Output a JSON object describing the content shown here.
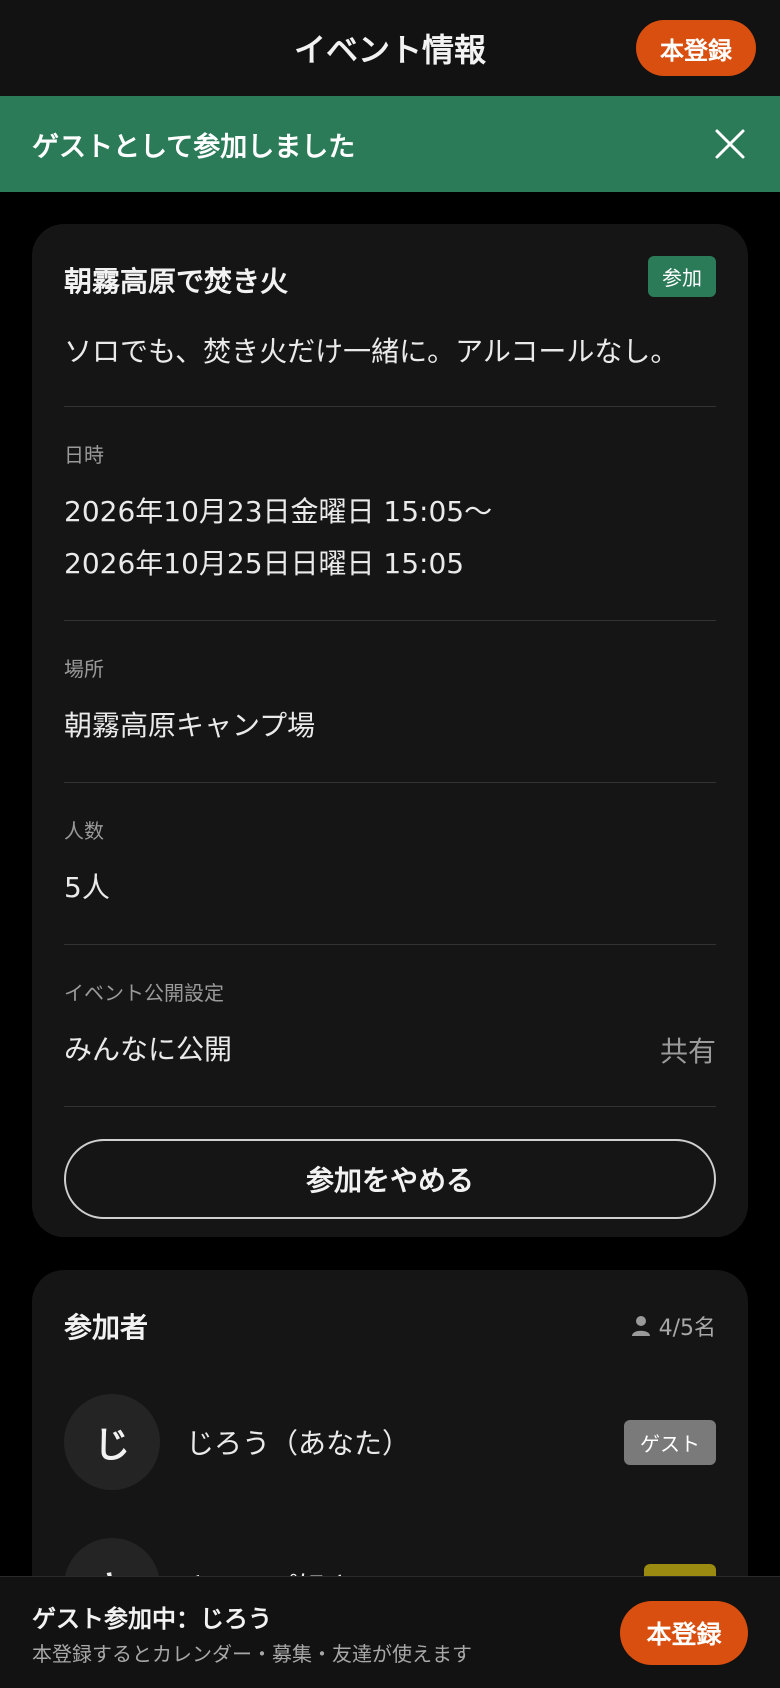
{
  "header": {
    "title": "イベント情報",
    "register_label": "本登録"
  },
  "toast": {
    "message": "ゲストとして参加しました",
    "close_icon": "close-icon"
  },
  "event": {
    "title": "朝霧高原で焚き火",
    "status_badge": "参加",
    "description": "ソロでも、焚き火だけ一緒に。アルコールなし。",
    "datetime_label": "日時",
    "datetime_start": "2026年10月23日金曜日 15:05〜",
    "datetime_end": "2026年10月25日日曜日 15:05",
    "place_label": "場所",
    "place_value": "朝霧高原キャンプ場",
    "capacity_label": "人数",
    "capacity_value": "5人",
    "visibility_label": "イベント公開設定",
    "visibility_value": "みんなに公開",
    "share_label": "共有",
    "cancel_label": "参加をやめる"
  },
  "participants": {
    "title": "参加者",
    "count": "4/5名",
    "members": [
      {
        "initial": "じ",
        "name": "じろう（あなた）",
        "badge": "ゲスト"
      },
      {
        "initial": "キ",
        "name": "キャンプ好き",
        "badge": "主催"
      }
    ]
  },
  "bottom_bar": {
    "title": "ゲスト参加中：じろう",
    "subtitle": "本登録するとカレンダー・募集・友達が使えます",
    "register_label": "本登録"
  },
  "colors": {
    "accent_orange": "#d94f0f",
    "toast_green": "#2b7a58",
    "guest_badge": "#7a7a7a",
    "host_badge": "#9a8a12"
  }
}
